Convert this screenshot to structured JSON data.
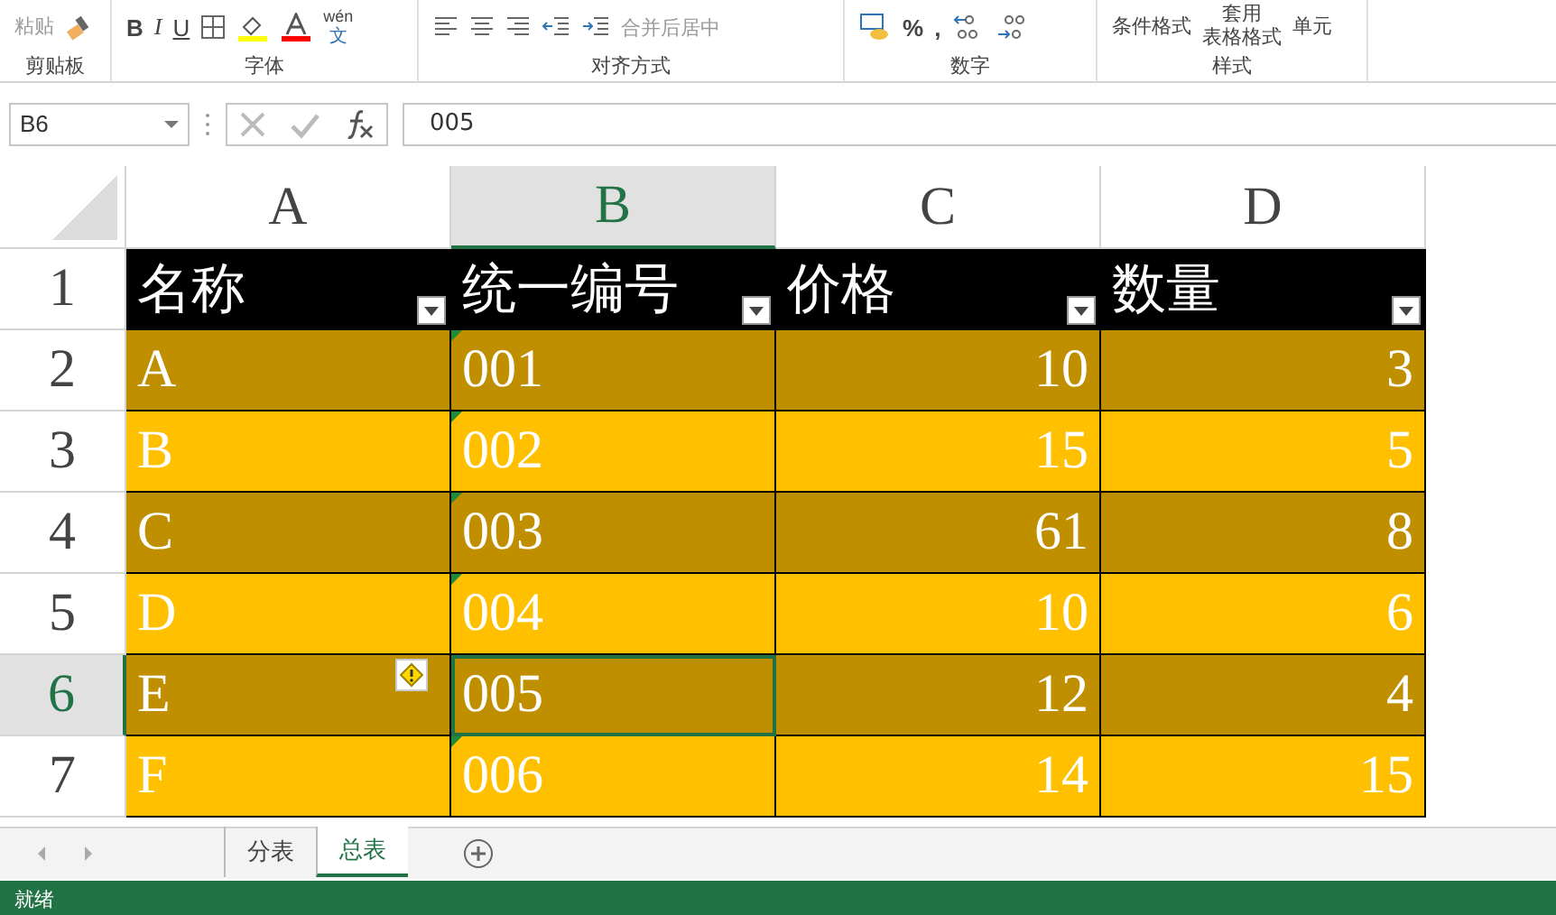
{
  "ribbon": {
    "groups": [
      {
        "label": "剪贴板",
        "items": [
          {
            "kind": "paste",
            "text": "粘贴"
          },
          {
            "kind": "brush"
          }
        ]
      },
      {
        "label": "字体",
        "items": [
          {
            "kind": "bold",
            "text": "B"
          },
          {
            "kind": "italic",
            "text": "I"
          },
          {
            "kind": "underline",
            "text": "U"
          },
          {
            "kind": "border"
          },
          {
            "kind": "fill-color"
          },
          {
            "kind": "font-color"
          },
          {
            "kind": "phonetic",
            "text": "wén",
            "text2": "文"
          }
        ]
      },
      {
        "label": "对齐方式",
        "items": [
          {
            "kind": "align-left"
          },
          {
            "kind": "align-center"
          },
          {
            "kind": "align-right"
          },
          {
            "kind": "outdent"
          },
          {
            "kind": "indent"
          },
          {
            "kind": "merge",
            "text": "合并后居中"
          }
        ]
      },
      {
        "label": "数字",
        "items": [
          {
            "kind": "currency"
          },
          {
            "kind": "symbol",
            "text": "%"
          },
          {
            "kind": "symbol",
            "text": ","
          },
          {
            "kind": "decimal-more"
          },
          {
            "kind": "decimal-less"
          }
        ]
      },
      {
        "label": "样式",
        "items": [
          {
            "kind": "stack",
            "text": "条件格式"
          },
          {
            "kind": "stack",
            "text": "套用",
            "text2": "表格格式"
          },
          {
            "kind": "stack",
            "text": "单元"
          }
        ]
      }
    ]
  },
  "formula_bar": {
    "name_box": "B6",
    "formula": "005"
  },
  "sheet": {
    "columns": [
      {
        "letter": "A",
        "selected": false,
        "kind": "text"
      },
      {
        "letter": "B",
        "selected": true,
        "kind": "text"
      },
      {
        "letter": "C",
        "selected": false,
        "kind": "number"
      },
      {
        "letter": "D",
        "selected": false,
        "kind": "number"
      }
    ],
    "rows": [
      {
        "number": "1",
        "selected": false,
        "kind": "header",
        "color": "#000000",
        "cells": [
          {
            "text": "名称"
          },
          {
            "text": "统一编号"
          },
          {
            "text": "价格"
          },
          {
            "text": "数量"
          }
        ]
      },
      {
        "number": "2",
        "selected": false,
        "kind": "data",
        "color": "#bf8f00",
        "cells": [
          {
            "text": "A"
          },
          {
            "text": "001",
            "flag": true
          },
          {
            "text": "10"
          },
          {
            "text": "3"
          }
        ]
      },
      {
        "number": "3",
        "selected": false,
        "kind": "data",
        "color": "#ffc000",
        "cells": [
          {
            "text": "B"
          },
          {
            "text": "002",
            "flag": true
          },
          {
            "text": "15"
          },
          {
            "text": "5"
          }
        ]
      },
      {
        "number": "4",
        "selected": false,
        "kind": "data",
        "color": "#bf8f00",
        "cells": [
          {
            "text": "C"
          },
          {
            "text": "003",
            "flag": true
          },
          {
            "text": "61"
          },
          {
            "text": "8"
          }
        ]
      },
      {
        "number": "5",
        "selected": false,
        "kind": "data",
        "color": "#ffc000",
        "cells": [
          {
            "text": "D"
          },
          {
            "text": "004",
            "flag": true
          },
          {
            "text": "10"
          },
          {
            "text": "6"
          }
        ]
      },
      {
        "number": "6",
        "selected": true,
        "kind": "data",
        "color": "#bf8f00",
        "cells": [
          {
            "text": "E",
            "warning": true
          },
          {
            "text": "005",
            "active": true
          },
          {
            "text": "12"
          },
          {
            "text": "4"
          }
        ]
      },
      {
        "number": "7",
        "selected": false,
        "kind": "data",
        "color": "#ffc000",
        "cells": [
          {
            "text": "F"
          },
          {
            "text": "006",
            "flag": true
          },
          {
            "text": "14"
          },
          {
            "text": "15"
          }
        ]
      }
    ]
  },
  "sheet_tabs": [
    {
      "label": "分表",
      "selected": false
    },
    {
      "label": "总表",
      "selected": true
    }
  ],
  "status_bar": {
    "text": "就绪"
  }
}
